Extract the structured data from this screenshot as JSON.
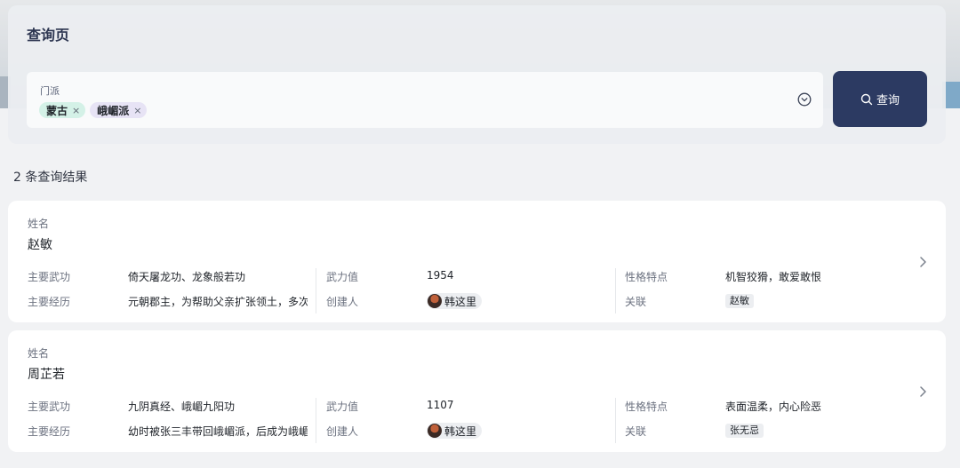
{
  "header": {
    "title": "查询页"
  },
  "filter": {
    "label": "门派",
    "tags": [
      {
        "text": "蒙古",
        "remove": "×"
      },
      {
        "text": "峨嵋派",
        "remove": "×"
      }
    ]
  },
  "search": {
    "label": "查询"
  },
  "results": {
    "count_text": "2 条查询结果",
    "cards": [
      {
        "name_label": "姓名",
        "name": "赵敏",
        "skill_label": "主要武功",
        "skill": "倚天屠龙功、龙象般若功",
        "history_label": "主要经历",
        "history": "元朝郡主，为帮助父亲扩张领土，多次",
        "power_label": "武力值",
        "power": "1954",
        "creator_label": "创建人",
        "creator": "韩这里",
        "trait_label": "性格特点",
        "trait": "机智狡猾，敢爱敢恨",
        "relation_label": "关联",
        "relation": "赵敏"
      },
      {
        "name_label": "姓名",
        "name": "周芷若",
        "skill_label": "主要武功",
        "skill": "九阴真经、峨嵋九阳功",
        "history_label": "主要经历",
        "history": "幼时被张三丰带回峨嵋派，后成为峨嵋",
        "power_label": "武力值",
        "power": "1107",
        "creator_label": "创建人",
        "creator": "韩这里",
        "trait_label": "性格特点",
        "trait": "表面温柔，内心险恶",
        "relation_label": "关联",
        "relation": "张无忌"
      }
    ]
  },
  "colors": {
    "accent": "#2c3a62",
    "tag_green": "#d4f1e7",
    "tag_purple": "#e7e3f5"
  }
}
